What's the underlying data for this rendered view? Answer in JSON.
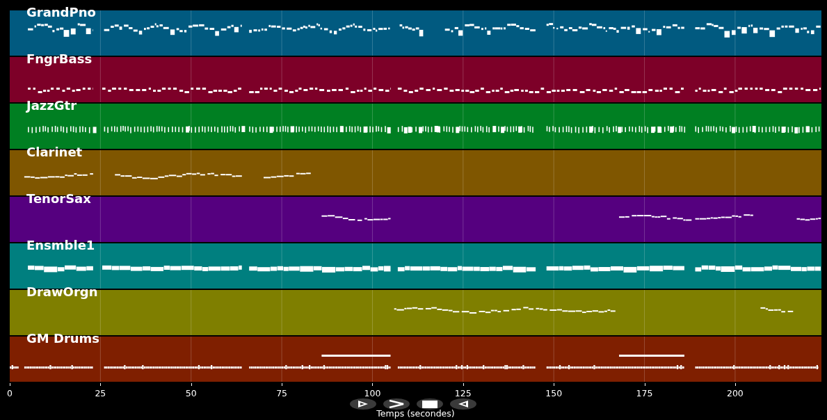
{
  "tracks": [
    {
      "name": "GrandPno",
      "color": "#015a80",
      "kind": "piano"
    },
    {
      "name": "FngrBass",
      "color": "#7d0028",
      "kind": "bass"
    },
    {
      "name": "JazzGtr",
      "color": "#007f22",
      "kind": "guitar"
    },
    {
      "name": "Clarinet",
      "color": "#7f5600",
      "kind": "lead"
    },
    {
      "name": "TenorSax",
      "color": "#55007f",
      "kind": "lead"
    },
    {
      "name": "Ensmble1",
      "color": "#007f7f",
      "kind": "pad"
    },
    {
      "name": "DrawOrgn",
      "color": "#7f7f00",
      "kind": "lead"
    },
    {
      "name": "GM Drums",
      "color": "#7f1f00",
      "kind": "drums"
    }
  ],
  "x_axis": {
    "ticks": [
      "0",
      "25",
      "50",
      "75",
      "100",
      "125",
      "150",
      "175",
      "200"
    ],
    "label": "Temps (secondes)"
  },
  "controls": [
    {
      "kind": "play"
    },
    {
      "kind": "forward"
    },
    {
      "kind": "stop"
    },
    {
      "kind": "back"
    }
  ]
}
